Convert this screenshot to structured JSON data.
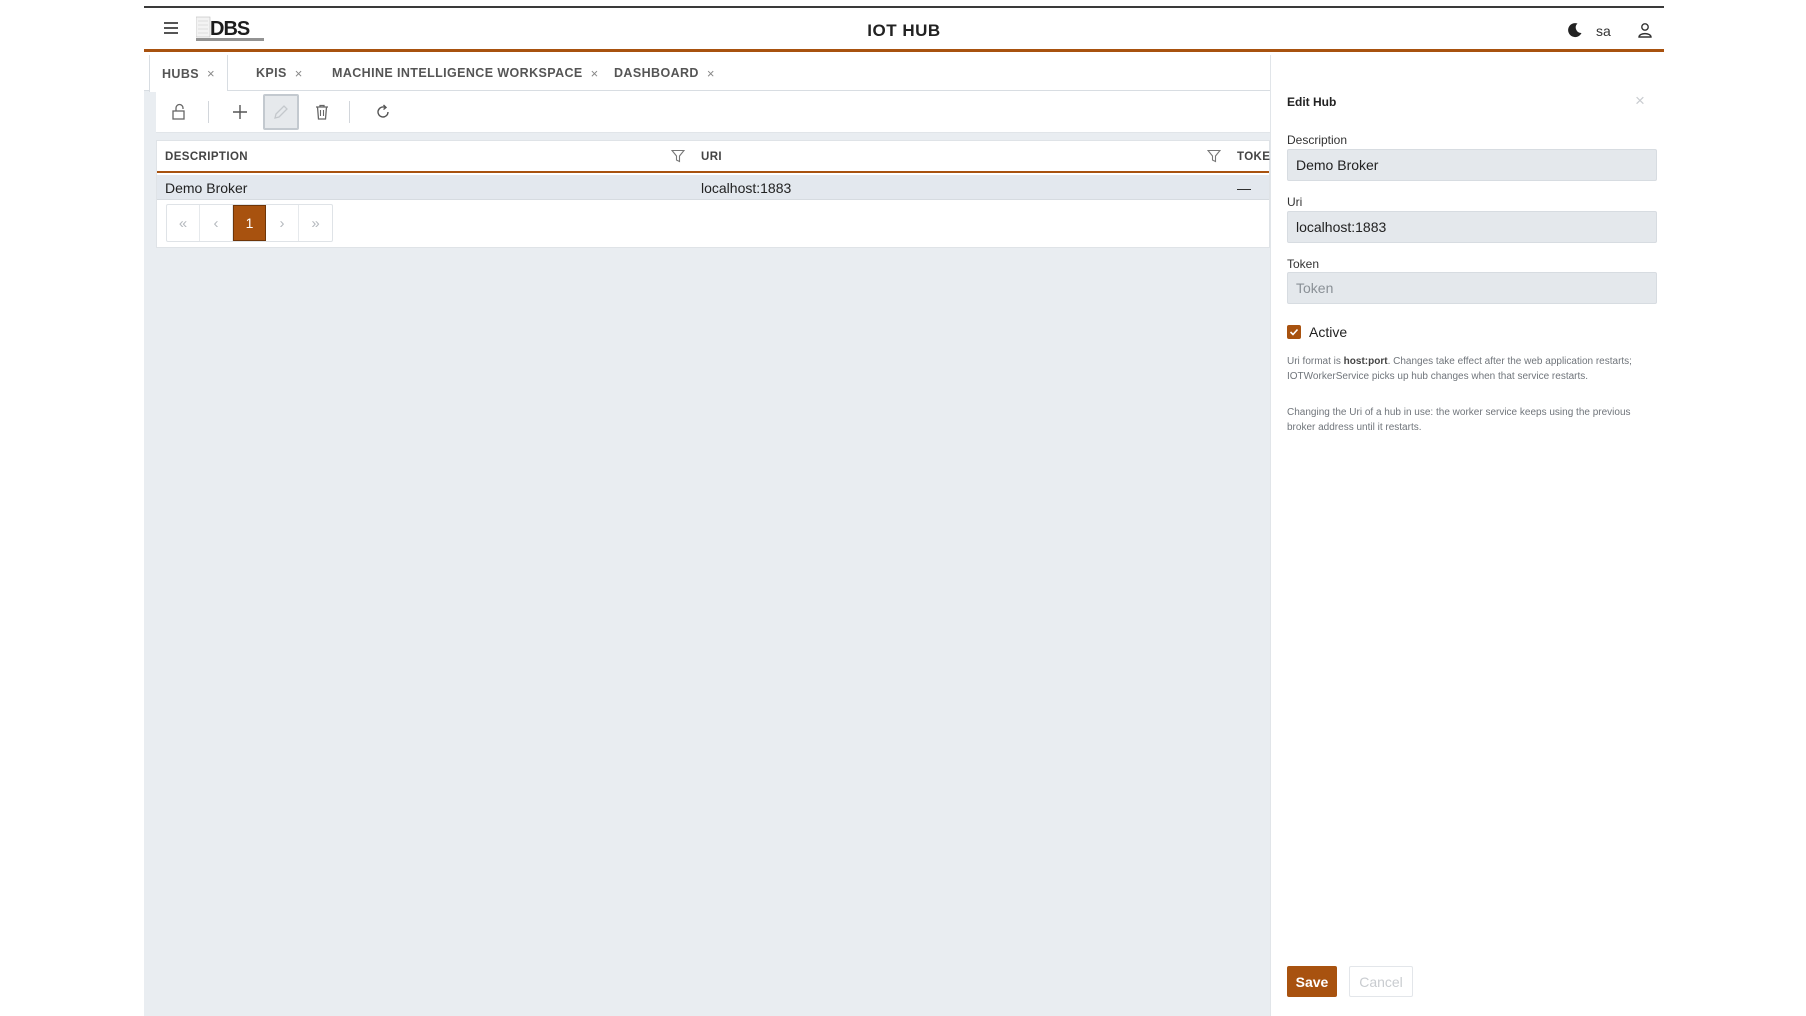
{
  "header": {
    "title": "IOT HUB",
    "user": "sa"
  },
  "tabs": [
    {
      "label": "HUBS",
      "close": "×"
    },
    {
      "label": "KPIS",
      "close": "×"
    },
    {
      "label": "MACHINE INTELLIGENCE WORKSPACE",
      "close": "×"
    },
    {
      "label": "DASHBOARD",
      "close": "×"
    }
  ],
  "toolbar": {
    "icons": [
      "unlock-icon",
      "add-icon",
      "edit-icon",
      "delete-icon",
      "refresh-icon"
    ]
  },
  "grid": {
    "columns": [
      "DESCRIPTION",
      "URI",
      "TOKEN"
    ],
    "rows": [
      {
        "description": "Demo Broker",
        "uri": "localhost:1883",
        "token": "—"
      }
    ],
    "pager": {
      "first": "«",
      "prev": "‹",
      "current": "1",
      "next": "›",
      "last": "»"
    }
  },
  "panel": {
    "title": "Edit Hub",
    "close": "×",
    "description_label": "Description",
    "description_value": "Demo Broker",
    "uri_label": "Uri",
    "uri_value": "localhost:1883",
    "token_label": "Token",
    "token_placeholder": "Token",
    "active_label": "Active",
    "active_checked": true,
    "help1_pre": "Uri format is ",
    "help1_bold": "host:port",
    "help1_post": ". Changes take effect after the web application restarts; IOTWorkerService picks up hub changes when that service restarts.",
    "help2": "Changing the Uri of a hub in use: the worker service keeps using the previous broker address until it restarts.",
    "save_label": "Save",
    "cancel_label": "Cancel"
  },
  "colors": {
    "accent": "#a8520f",
    "content_bg": "#e9edf1",
    "selected_row": "#e3e8ee"
  }
}
